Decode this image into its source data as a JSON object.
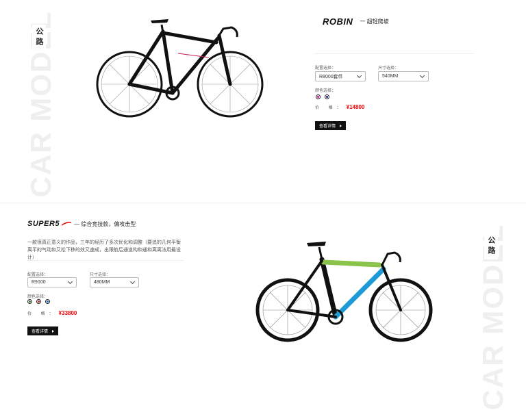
{
  "products": [
    {
      "category": "公路",
      "bg_text": "CAR MODEL",
      "brand": "ROBIN",
      "tagline": "一 超轻爬坡",
      "spec_label": "配置选择：",
      "spec_value": "R8000套件",
      "size_label": "尺寸选择：",
      "size_value": "540MM",
      "color_label": "颜色选择：",
      "colors": [
        "#cc0099",
        "#1a1a7a"
      ],
      "price_label": "价 格：",
      "price": "¥14800",
      "button": "查看详情",
      "bike_color": "#111111",
      "bike_accent": "#c2185b"
    },
    {
      "category": "公路",
      "bg_text": "CAR MODEL",
      "brand": "SUPER5",
      "tagline": "— 综合竞技款，偏攻击型",
      "description": "一款很真正意义的作品，三年的经历了多次优化和调整（要追的几何平衡离平的气动和又松下移的效又速成，出限航后通道构和通和离离法用最设计）",
      "spec_label": "配置选择：",
      "spec_value": "R9100",
      "size_label": "尺寸选择：",
      "size_value": "480MM",
      "color_label": "颜色选择：",
      "colors": [
        "#2e7d32",
        "#c62828",
        "#1565c0"
      ],
      "price_label": "价 格：",
      "price": "¥33800",
      "button": "查看详情",
      "bike_color": "#111111",
      "bike_accent": "#1e9bd7",
      "bike_accent2": "#8bc34a"
    }
  ]
}
